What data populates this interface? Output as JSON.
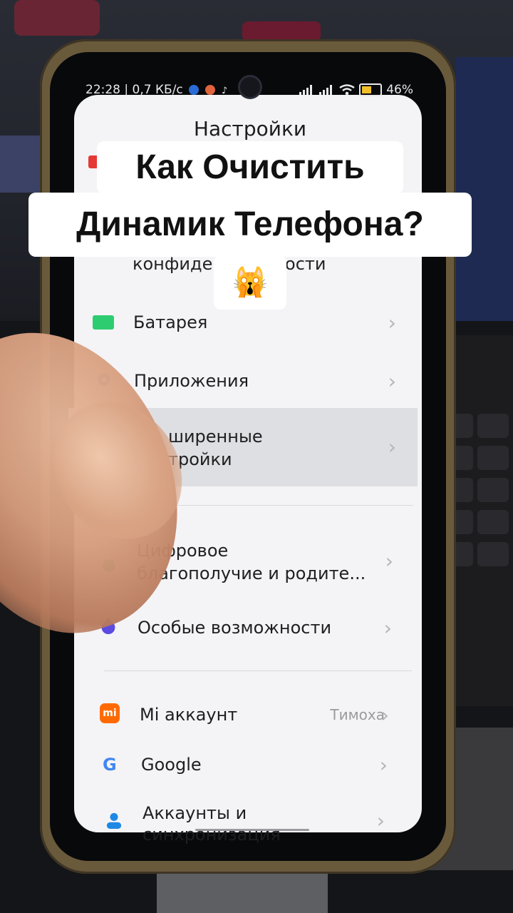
{
  "status_bar": {
    "time_and_speed": "22:28 | 0,7 КБ/с",
    "battery_percent": "46%"
  },
  "screen": {
    "title": "Настройки",
    "privacy_partial": "конфиде",
    "privacy_suffix": "ности"
  },
  "settings": {
    "battery": {
      "label": "Батарея",
      "icon": "battery-icon",
      "color": "#2ecc71"
    },
    "apps": {
      "label": "Приложения",
      "icon": "gear-icon",
      "color": "#1e88e5"
    },
    "advanced": {
      "label_line1": "ширенные",
      "label_line2": "тройки"
    },
    "digital_wellbeing": {
      "label_line1": "Цифровое",
      "label_line2": "благополучие и родите...",
      "icon": "heart-icon",
      "color": "#2ecc71"
    },
    "accessibility": {
      "label": "Особые возможности",
      "icon": "accessibility-icon",
      "color": "#5b4be0"
    },
    "mi_account": {
      "label": "Mi аккаунт",
      "value": "Тимоха",
      "icon": "mi-logo-icon",
      "color": "#ff6a00"
    },
    "google": {
      "label": "Google",
      "icon": "google-icon"
    },
    "accounts": {
      "label_line1": "Аккаунты и",
      "label_line2": "синхронизация",
      "icon": "person-icon",
      "color": "#1e88e5"
    }
  },
  "caption": {
    "line1": "Как Очистить",
    "line2": "Динамик Телефона?",
    "emoji": "🙀"
  }
}
